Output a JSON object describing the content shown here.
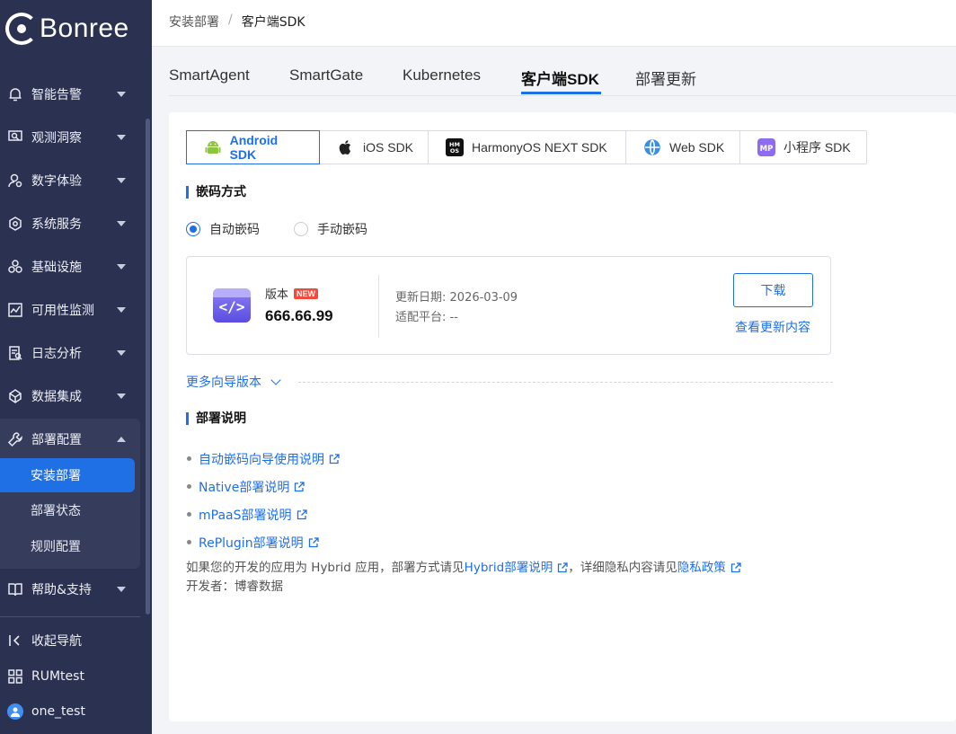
{
  "brand": {
    "name": "Bonree"
  },
  "sidebar": {
    "items": [
      {
        "label": "智能告警",
        "icon": "alert-icon"
      },
      {
        "label": "观测洞察",
        "icon": "insight-icon"
      },
      {
        "label": "数字体验",
        "icon": "user-experience-icon"
      },
      {
        "label": "系统服务",
        "icon": "system-service-icon"
      },
      {
        "label": "基础设施",
        "icon": "infrastructure-icon"
      },
      {
        "label": "可用性监测",
        "icon": "availability-icon"
      },
      {
        "label": "日志分析",
        "icon": "log-icon"
      },
      {
        "label": "数据集成",
        "icon": "data-integration-icon"
      },
      {
        "label": "部署配置",
        "icon": "wrench-icon"
      }
    ],
    "sub_items": [
      {
        "label": "安装部署",
        "active": true
      },
      {
        "label": "部署状态",
        "active": false
      },
      {
        "label": "规则配置",
        "active": false
      }
    ],
    "help": {
      "label": "帮助&支持",
      "icon": "book-icon"
    },
    "footer": [
      {
        "label": "收起导航",
        "icon": "collapse-icon"
      },
      {
        "label": "RUMtest",
        "icon": "apps-grid-icon"
      },
      {
        "label": "one_test",
        "icon": "avatar-icon"
      }
    ]
  },
  "breadcrumb": {
    "parent": "安装部署",
    "separator": "/",
    "current": "客户端SDK"
  },
  "tabs": [
    {
      "label": "SmartAgent",
      "active": false
    },
    {
      "label": "SmartGate",
      "active": false
    },
    {
      "label": "Kubernetes",
      "active": false
    },
    {
      "label": "客户端SDK",
      "active": true
    },
    {
      "label": "部署更新",
      "active": false
    }
  ],
  "sdk_tabs": [
    {
      "label": "Android SDK",
      "icon": "android-icon",
      "active": true
    },
    {
      "label": "iOS SDK",
      "icon": "apple-icon",
      "active": false
    },
    {
      "label": "HarmonyOS NEXT SDK",
      "icon": "harmonyos-icon",
      "active": false
    },
    {
      "label": "Web SDK",
      "icon": "globe-icon",
      "active": false
    },
    {
      "label": "小程序 SDK",
      "icon": "miniprogram-icon",
      "active": false
    }
  ],
  "embed_section": {
    "title": "嵌码方式",
    "options": [
      {
        "label": "自动嵌码",
        "selected": true
      },
      {
        "label": "手动嵌码",
        "selected": false
      }
    ]
  },
  "version_card": {
    "version_label": "版本",
    "badge": "NEW",
    "version": "666.66.99",
    "update_date_label": "更新日期:",
    "update_date": "2026-03-09",
    "platform_label": "适配平台:",
    "platform": "--",
    "download_label": "下载",
    "whats_new_label": "查看更新内容"
  },
  "more_versions_label": "更多向导版本",
  "deploy_section": {
    "title": "部署说明",
    "links": [
      "自动嵌码向导使用说明",
      "Native部署说明",
      "mPaaS部署说明",
      "RePlugin部署说明"
    ],
    "note_prefix": "如果您的开发的应用为 Hybrid 应用，部署方式请见",
    "note_hybrid_link": "Hybrid部署说明",
    "note_middle": "，详细隐私内容请见",
    "note_privacy_link": "隐私政策",
    "developer_label": "开发者：",
    "developer": "博睿数据"
  },
  "colors": {
    "accent": "#1f6fe5",
    "sidebar_bg": "#2b3150",
    "badge_red": "#f24b3e"
  }
}
